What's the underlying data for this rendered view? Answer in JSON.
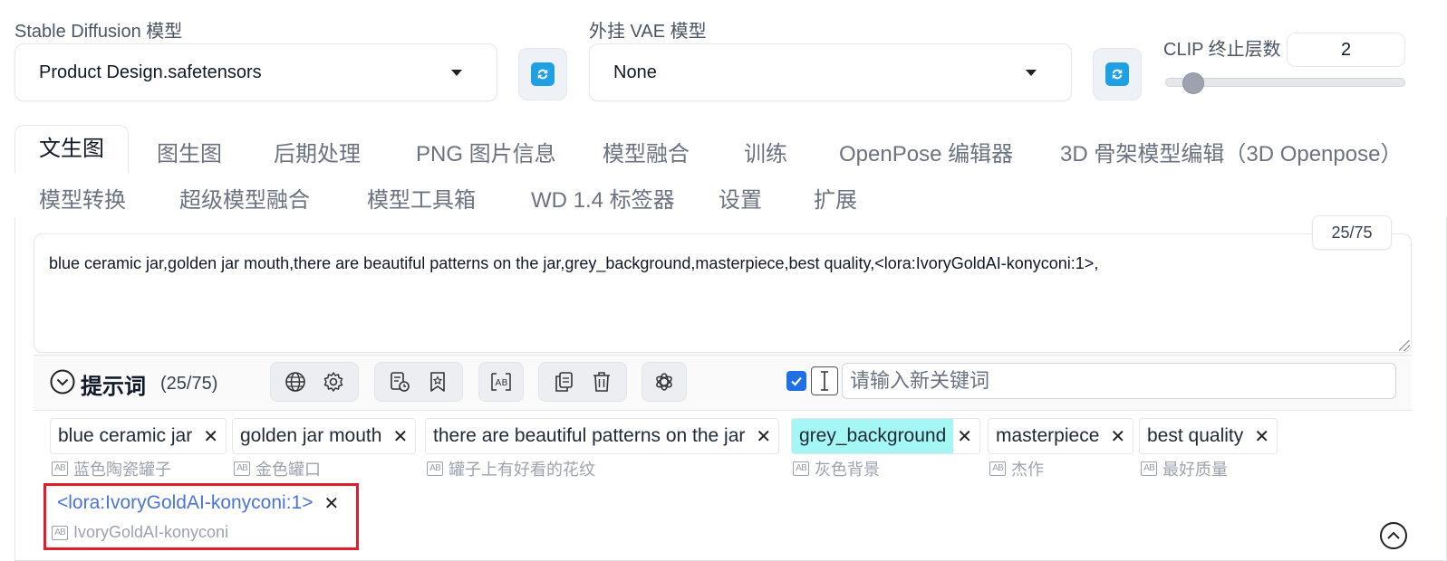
{
  "top": {
    "sd_model_label": "Stable Diffusion 模型",
    "sd_model_value": "Product Design.safetensors",
    "vae_label": "外挂 VAE 模型",
    "vae_value": "None",
    "clip_label": "CLIP 终止层数",
    "clip_value": "2",
    "clip_slider_fraction": 0.08
  },
  "tabs": {
    "row1": [
      "文生图",
      "图生图",
      "后期处理",
      "PNG 图片信息",
      "模型融合",
      "训练",
      "OpenPose 编辑器",
      "3D 骨架模型编辑（3D Openpose）"
    ],
    "row2": [
      "模型转换",
      "超级模型融合",
      "模型工具箱",
      "WD 1.4 标签器",
      "设置",
      "扩展"
    ],
    "active": "文生图"
  },
  "prompt": {
    "counter": "25/75",
    "text": "blue ceramic jar,golden jar mouth,there are beautiful patterns on the jar,grey_background,masterpiece,best quality,<lora:IvoryGoldAI-konyconi:1>,"
  },
  "toolbar": {
    "title": "提示词",
    "count": "(25/75)",
    "keyword_placeholder": "请输入新关键词",
    "icons": [
      "globe-icon",
      "settings-icon",
      "history-icon",
      "bookmark-icon",
      "translate-icon",
      "copy-icon",
      "trash-icon",
      "openai-icon"
    ]
  },
  "tags": [
    {
      "text": "blue ceramic jar",
      "translation": "蓝色陶瓷罐子",
      "highlight": false
    },
    {
      "text": "golden jar mouth",
      "translation": "金色罐口",
      "highlight": false
    },
    {
      "text": "there are beautiful patterns on the jar",
      "translation": "罐子上有好看的花纹",
      "highlight": false
    },
    {
      "text": "grey_background",
      "translation": "灰色背景",
      "highlight": true
    },
    {
      "text": "masterpiece",
      "translation": "杰作",
      "highlight": false
    },
    {
      "text": "best quality",
      "translation": "最好质量",
      "highlight": false
    },
    {
      "text": "<lora:IvoryGoldAI-konyconi:1>",
      "translation": "IvoryGoldAI-konyconi",
      "highlight": false,
      "lora": true
    }
  ],
  "colors": {
    "highlight": "#a5f7f5",
    "lora_text": "#4a74d8",
    "accent": "#1f6fe5",
    "refresh": "#1ea0e3",
    "annotation_box": "#e11d2b"
  }
}
